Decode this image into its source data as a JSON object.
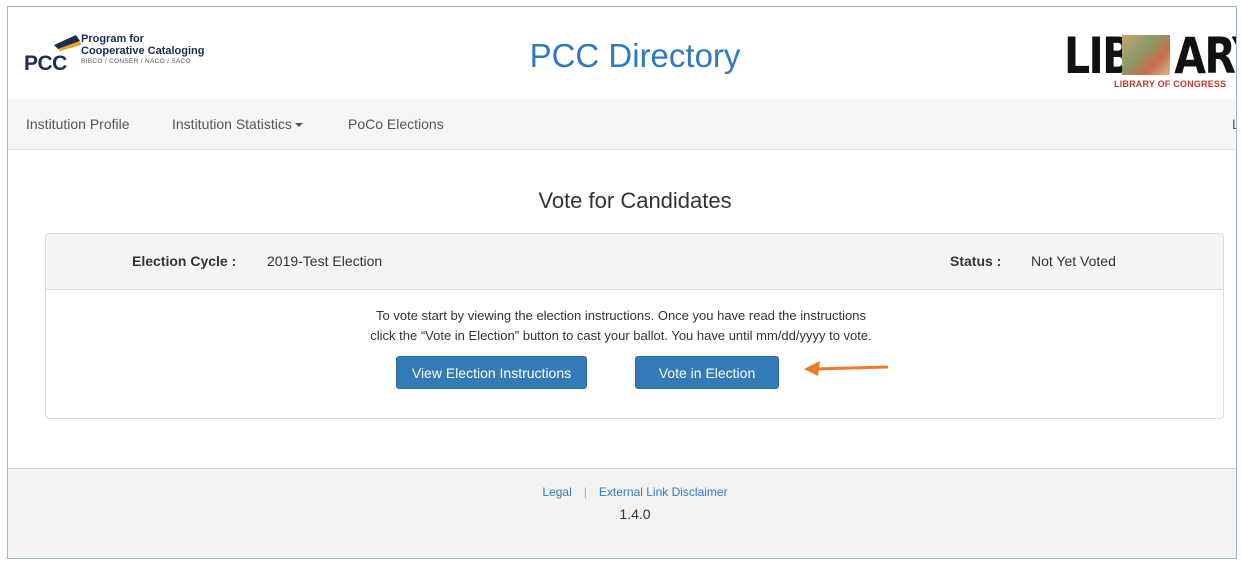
{
  "header": {
    "pcc_logo": {
      "abbr": "PCC",
      "line1": "Program for",
      "line2": "Cooperative Cataloging",
      "line3": "BIBCO / CONSER / NACO / SACO"
    },
    "title": "PCC Directory",
    "loc_logo": {
      "word": "LIBR  ARY",
      "subtitle": "LIBRARY OF CONGRESS"
    }
  },
  "nav": {
    "items": [
      {
        "label": "Institution Profile"
      },
      {
        "label": "Institution Statistics"
      },
      {
        "label": "PoCo Elections"
      }
    ],
    "right_item": "L"
  },
  "main": {
    "title": "Vote for Candidates",
    "panel": {
      "election_cycle_label": "Election Cycle :",
      "election_cycle_value": "2019-Test Election",
      "status_label": "Status :",
      "status_value": "Not Yet Voted",
      "instructions_line1": "To vote start by viewing the election instructions. Once you have read the instructions",
      "instructions_line2": "click the “Vote in Election” button to cast your ballot. You have until mm/dd/yyyy to vote.",
      "view_button": "View Election Instructions",
      "vote_button": "Vote in Election"
    },
    "arrow_color": "#f07a2a"
  },
  "footer": {
    "legal": "Legal",
    "disclaimer": "External Link Disclaimer",
    "version": "1.4.0"
  },
  "colors": {
    "brand_blue": "#337ab7",
    "title_blue": "#2f79be"
  }
}
